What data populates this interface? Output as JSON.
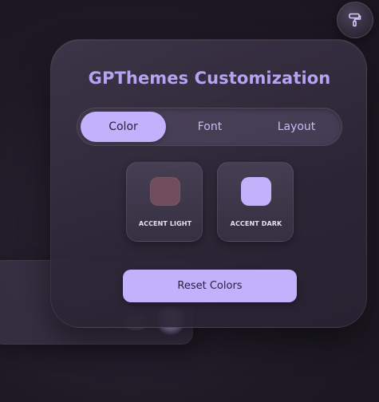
{
  "theme_button": {
    "icon": "paint-roller-icon"
  },
  "panel": {
    "title": "GPThemes Customization",
    "tabs": [
      {
        "label": "Color",
        "active": true
      },
      {
        "label": "Font",
        "active": false
      },
      {
        "label": "Layout",
        "active": false
      }
    ],
    "swatches": [
      {
        "label": "ACCENT LIGHT",
        "color": "#704d5c"
      },
      {
        "label": "ACCENT DARK",
        "color": "#c3b1fb"
      }
    ],
    "reset_label": "Reset Colors"
  },
  "colors": {
    "accent": "#c3b1fb",
    "title": "#b6a3f2",
    "background": "#1e1a25"
  }
}
